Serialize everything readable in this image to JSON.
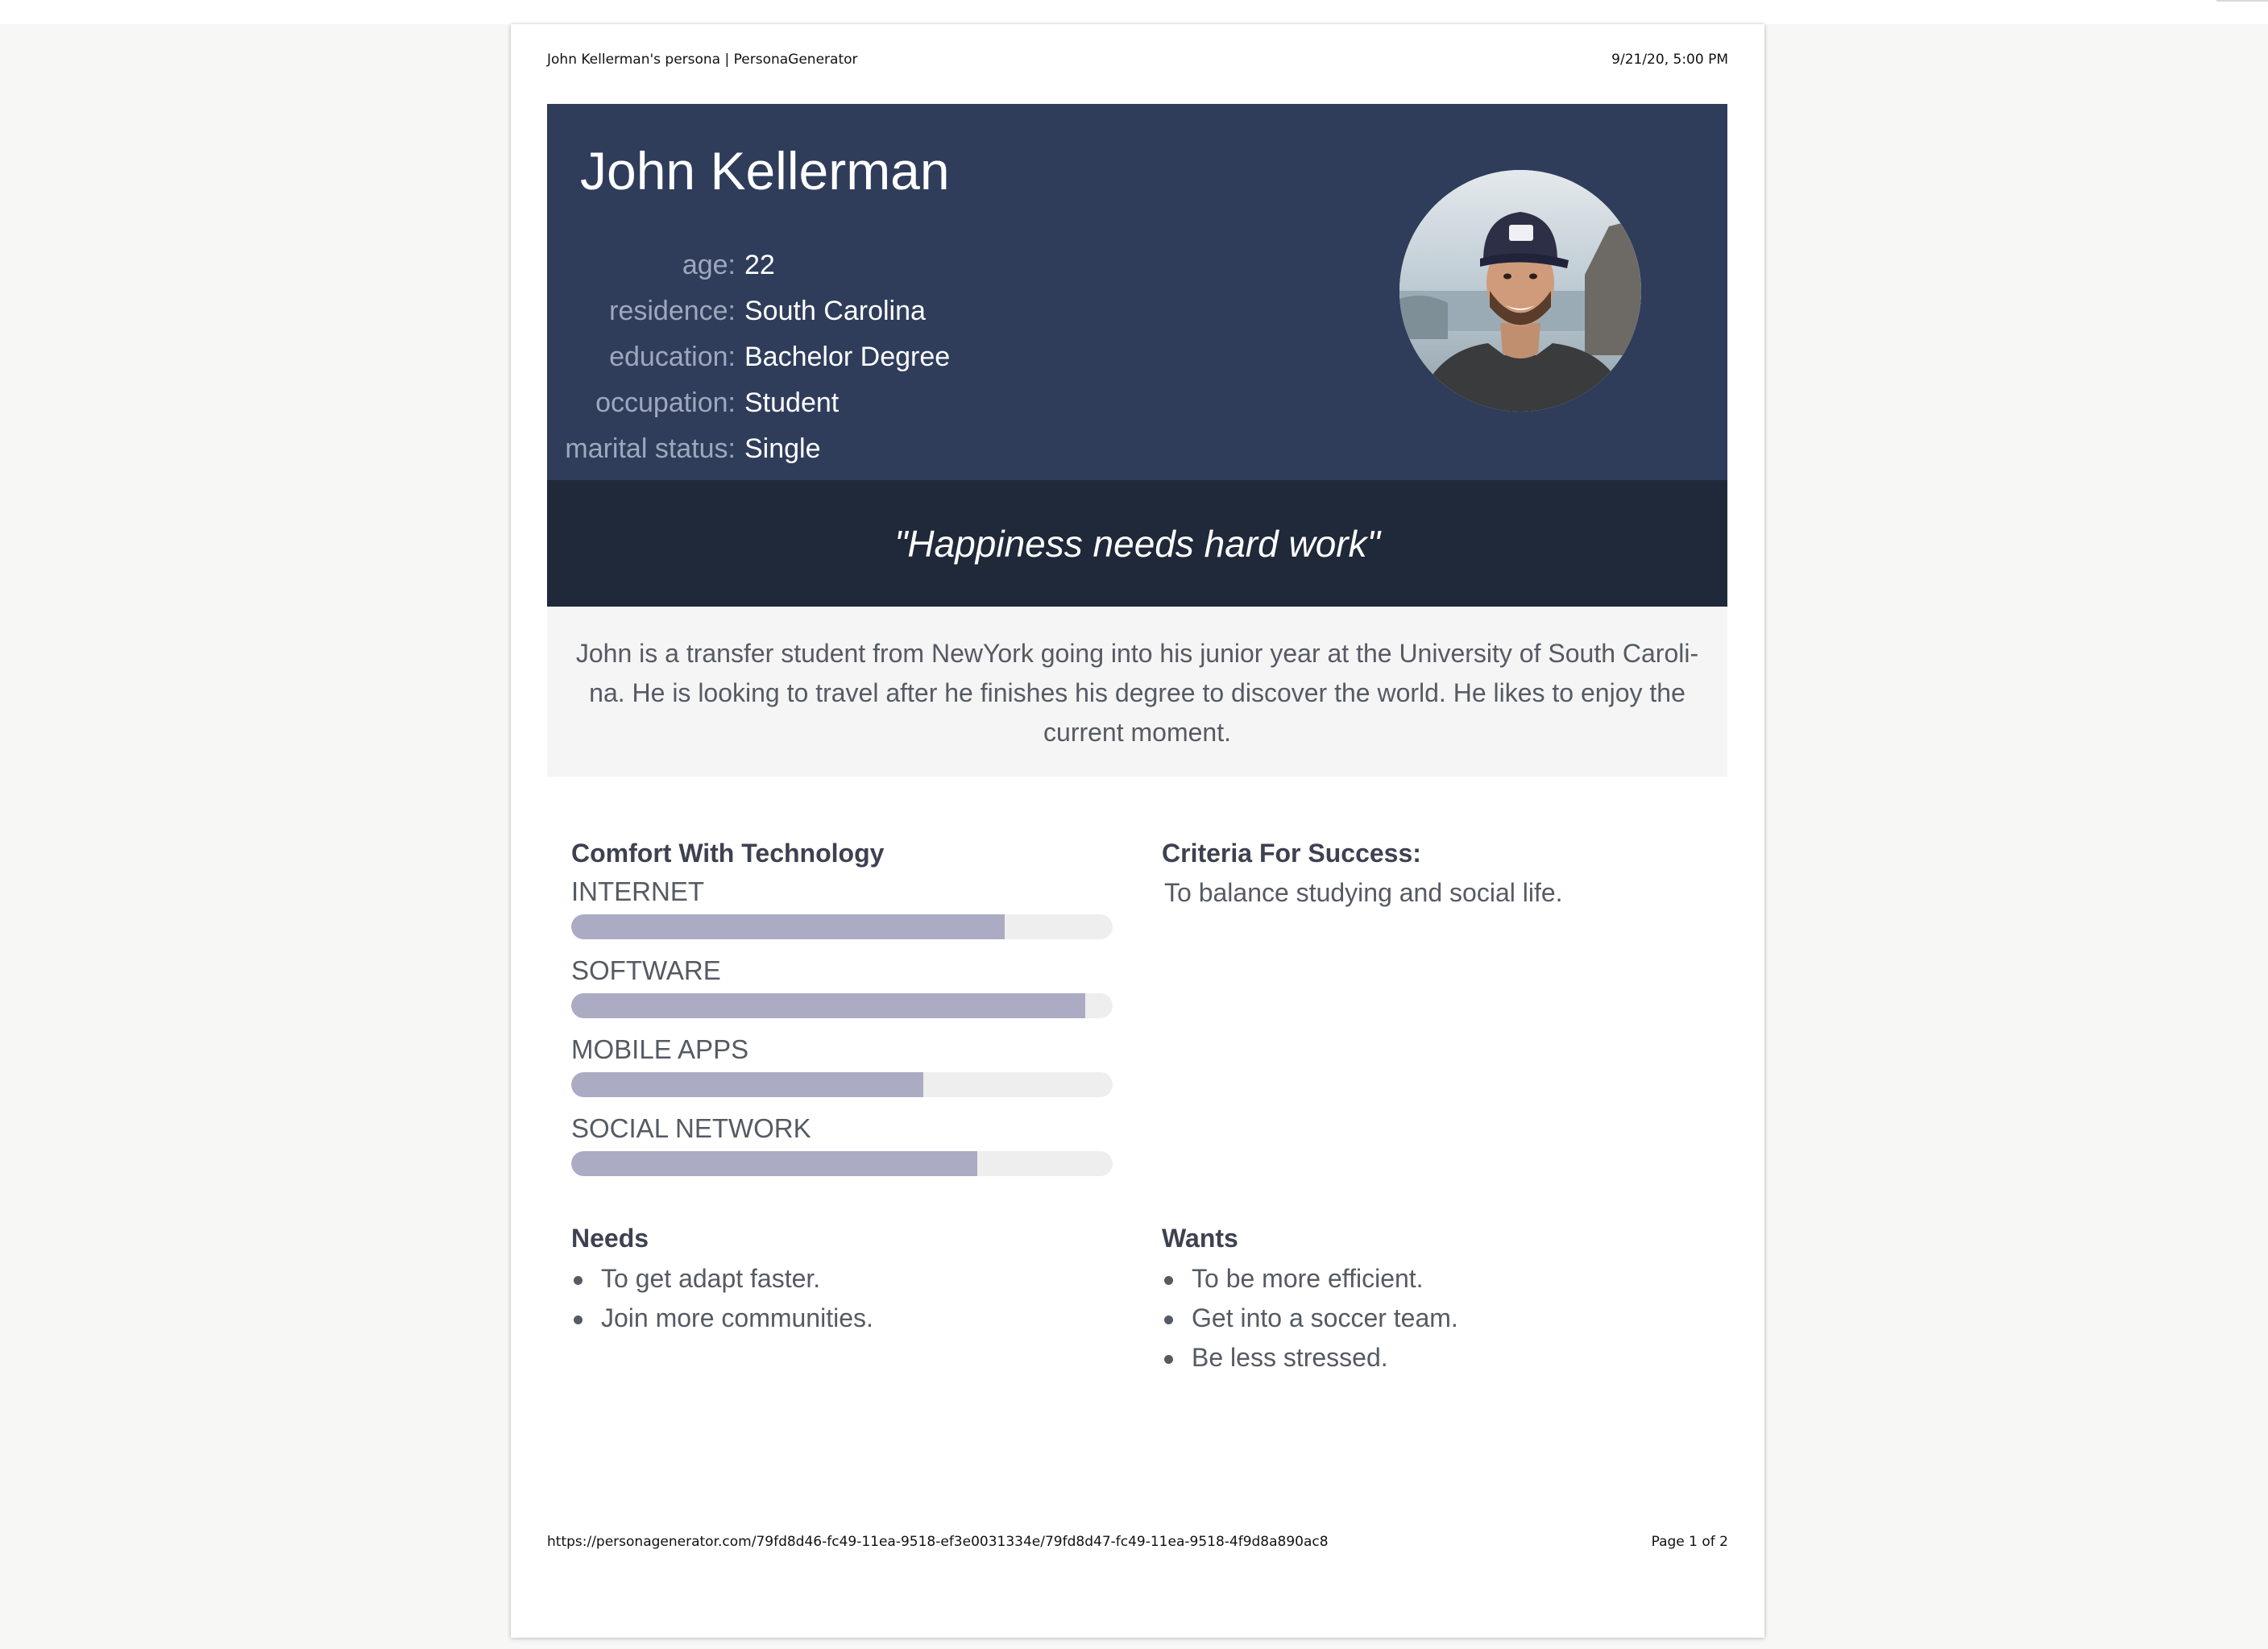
{
  "print_header": {
    "title": "John Kellerman's persona | PersonaGenerator",
    "datetime": "9/21/20, 5:00 PM"
  },
  "print_footer": {
    "url": "https://personagenerator.com/79fd8d46-fc49-11ea-9518-ef3e0031334e/79fd8d47-fc49-11ea-9518-4f9d8a890ac8",
    "page": "Page 1 of 2"
  },
  "persona": {
    "name": "John Kellerman",
    "facts": [
      {
        "label": "age:",
        "value": "22"
      },
      {
        "label": "residence:",
        "value": "South Carolina"
      },
      {
        "label": "education:",
        "value": "Bachelor Degree"
      },
      {
        "label": "occupation:",
        "value": "Student"
      },
      {
        "label": "marital status:",
        "value": "Single"
      }
    ],
    "photo_icon": "avatar-photo",
    "quote": "\"Happiness needs hard work\"",
    "bio": "John is a transfer student from NewYork going into his junior year at the University of South Caroli- na. He is looking to travel after he finishes his degree to discover the world. He likes to enjoy the current moment."
  },
  "tech": {
    "title": "Comfort With Technology",
    "skills": [
      {
        "label": "INTERNET",
        "level": 0.8
      },
      {
        "label": "SOFTWARE",
        "level": 0.95
      },
      {
        "label": "MOBILE APPS",
        "level": 0.65
      },
      {
        "label": "SOCIAL NETWORK",
        "level": 0.75
      }
    ]
  },
  "criteria": {
    "title": "Criteria For Success:",
    "text": "To balance studying and social life."
  },
  "needs": {
    "title": "Needs",
    "items": [
      "To get adapt faster.",
      "Join more communities."
    ]
  },
  "wants": {
    "title": "Wants",
    "items": [
      "To be more efficient.",
      "Get into a soccer team.",
      "Be less stressed."
    ]
  },
  "colors": {
    "hero_bg": "#2f3d5b",
    "quote_bg": "#202939",
    "bar_fill": "#abacc3",
    "bar_track": "#eeeeee"
  }
}
